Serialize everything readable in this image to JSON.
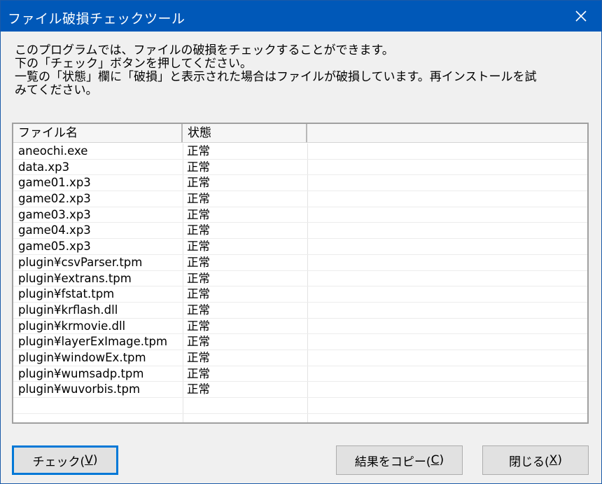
{
  "window": {
    "title": "ファイル破損チェックツール",
    "close_glyph": "✕"
  },
  "description": {
    "lines": [
      "このプログラムでは、ファイルの破損をチェックすることができます。",
      "下の「チェック」ボタンを押してください。",
      "一覧の「状態」欄に「破損」と表示された場合はファイルが破損しています。再インストールを試",
      "みてください。"
    ]
  },
  "list": {
    "columns": [
      "ファイル名",
      "状態",
      ""
    ],
    "rows": [
      {
        "file": "aneochi.exe",
        "status": "正常"
      },
      {
        "file": "data.xp3",
        "status": "正常"
      },
      {
        "file": "game01.xp3",
        "status": "正常"
      },
      {
        "file": "game02.xp3",
        "status": "正常"
      },
      {
        "file": "game03.xp3",
        "status": "正常"
      },
      {
        "file": "game04.xp3",
        "status": "正常"
      },
      {
        "file": "game05.xp3",
        "status": "正常"
      },
      {
        "file": "plugin¥csvParser.tpm",
        "status": "正常"
      },
      {
        "file": "plugin¥extrans.tpm",
        "status": "正常"
      },
      {
        "file": "plugin¥fstat.tpm",
        "status": "正常"
      },
      {
        "file": "plugin¥krflash.dll",
        "status": "正常"
      },
      {
        "file": "plugin¥krmovie.dll",
        "status": "正常"
      },
      {
        "file": "plugin¥layerExImage.tpm",
        "status": "正常"
      },
      {
        "file": "plugin¥windowEx.tpm",
        "status": "正常"
      },
      {
        "file": "plugin¥wumsadp.tpm",
        "status": "正常"
      },
      {
        "file": "plugin¥wuvorbis.tpm",
        "status": "正常"
      }
    ]
  },
  "buttons": {
    "check": {
      "label": "チェック(",
      "accel": "V",
      "suffix": ")"
    },
    "copy": {
      "label": "結果をコピー(",
      "accel": "C",
      "suffix": ")"
    },
    "close": {
      "label": "閉じる(",
      "accel": "X",
      "suffix": ")"
    }
  },
  "colors": {
    "titlebar": "#0058b8",
    "accent": "#0078d7"
  }
}
